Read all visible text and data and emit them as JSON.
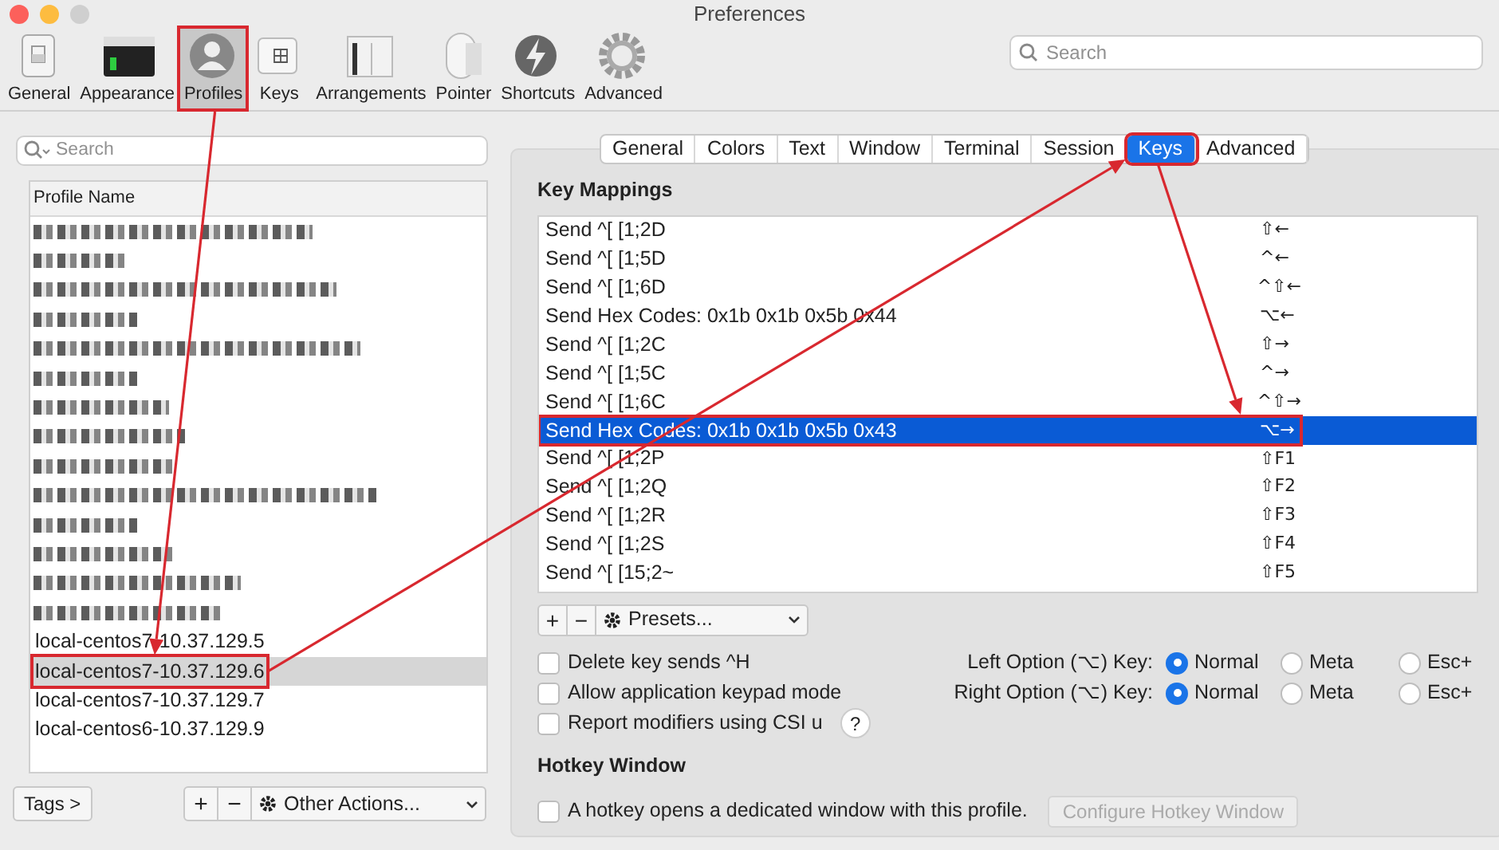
{
  "window": {
    "title": "Preferences"
  },
  "toolbar": [
    {
      "label": "General",
      "selected": false,
      "highlighted": false
    },
    {
      "label": "Appearance",
      "selected": false,
      "highlighted": false
    },
    {
      "label": "Profiles",
      "selected": true,
      "highlighted": true
    },
    {
      "label": "Keys",
      "selected": false,
      "highlighted": false
    },
    {
      "label": "Arrangements",
      "selected": false,
      "highlighted": false
    },
    {
      "label": "Pointer",
      "selected": false,
      "highlighted": false
    },
    {
      "label": "Shortcuts",
      "selected": false,
      "highlighted": false
    },
    {
      "label": "Advanced",
      "selected": false,
      "highlighted": false
    }
  ],
  "search": {
    "placeholder": "Search"
  },
  "profiles": {
    "search_placeholder": "Search",
    "column": "Profile Name",
    "rows": [
      {
        "kind": "redacted",
        "selected": false
      },
      {
        "kind": "redacted",
        "selected": false
      },
      {
        "kind": "redacted",
        "selected": false
      },
      {
        "kind": "redacted",
        "selected": false
      },
      {
        "kind": "redacted",
        "selected": false
      },
      {
        "kind": "redacted",
        "selected": false
      },
      {
        "kind": "redacted",
        "selected": false
      },
      {
        "kind": "redacted",
        "selected": false
      },
      {
        "kind": "redacted",
        "selected": false
      },
      {
        "kind": "redacted",
        "selected": false
      },
      {
        "kind": "redacted",
        "selected": false
      },
      {
        "kind": "redacted",
        "selected": false
      },
      {
        "kind": "redacted",
        "selected": false
      },
      {
        "kind": "redacted",
        "selected": false
      },
      {
        "kind": "text",
        "name": "local-centos7-10.37.129.5",
        "selected": false,
        "highlighted": false
      },
      {
        "kind": "text",
        "name": "local-centos7-10.37.129.6",
        "selected": true,
        "highlighted": true
      },
      {
        "kind": "text",
        "name": "local-centos7-10.37.129.7",
        "selected": false,
        "highlighted": false
      },
      {
        "kind": "text",
        "name": "local-centos6-10.37.129.9",
        "selected": false,
        "highlighted": false
      }
    ],
    "tags_button": "Tags >",
    "add": "+",
    "remove": "−",
    "actions": "Other Actions..."
  },
  "tabs": [
    {
      "label": "General",
      "selected": false,
      "highlighted": false
    },
    {
      "label": "Colors",
      "selected": false,
      "highlighted": false
    },
    {
      "label": "Text",
      "selected": false,
      "highlighted": false
    },
    {
      "label": "Window",
      "selected": false,
      "highlighted": false
    },
    {
      "label": "Terminal",
      "selected": false,
      "highlighted": false
    },
    {
      "label": "Session",
      "selected": false,
      "highlighted": false
    },
    {
      "label": "Keys",
      "selected": true,
      "highlighted": true
    },
    {
      "label": "Advanced",
      "selected": false,
      "highlighted": false
    }
  ],
  "key_mappings": {
    "title": "Key Mappings",
    "rows": [
      {
        "action": "Send ^[ [1;2D",
        "keys": "⇧←",
        "selected": false,
        "highlighted": false
      },
      {
        "action": "Send ^[ [1;5D",
        "keys": "^←",
        "selected": false,
        "highlighted": false
      },
      {
        "action": "Send ^[ [1;6D",
        "keys": "^⇧←",
        "selected": false,
        "highlighted": false
      },
      {
        "action": "Send Hex Codes: 0x1b 0x1b 0x5b 0x44",
        "keys": "⌥←",
        "selected": false,
        "highlighted": false
      },
      {
        "action": "Send ^[ [1;2C",
        "keys": "⇧→",
        "selected": false,
        "highlighted": false
      },
      {
        "action": "Send ^[ [1;5C",
        "keys": "^→",
        "selected": false,
        "highlighted": false
      },
      {
        "action": "Send ^[ [1;6C",
        "keys": "^⇧→",
        "selected": false,
        "highlighted": false
      },
      {
        "action": "Send Hex Codes: 0x1b 0x1b 0x5b 0x43",
        "keys": "⌥→",
        "selected": true,
        "highlighted": true
      },
      {
        "action": "Send ^[ [1;2P",
        "keys": "⇧F1",
        "selected": false,
        "highlighted": false
      },
      {
        "action": "Send ^[ [1;2Q",
        "keys": "⇧F2",
        "selected": false,
        "highlighted": false
      },
      {
        "action": "Send ^[ [1;2R",
        "keys": "⇧F3",
        "selected": false,
        "highlighted": false
      },
      {
        "action": "Send ^[ [1;2S",
        "keys": "⇧F4",
        "selected": false,
        "highlighted": false
      },
      {
        "action": "Send ^[ [15;2~",
        "keys": "⇧F5",
        "selected": false,
        "highlighted": false
      }
    ],
    "add": "+",
    "remove": "−",
    "presets": "Presets..."
  },
  "options": [
    {
      "label": "Delete key sends ^H",
      "checked": false
    },
    {
      "label": "Allow application keypad mode",
      "checked": false
    },
    {
      "label": "Report modifiers using CSI u",
      "checked": false,
      "help": "?"
    }
  ],
  "option_keys": [
    {
      "label": "Left Option (⌥) Key:",
      "choices": [
        {
          "label": "Normal",
          "selected": true
        },
        {
          "label": "Meta",
          "selected": false
        },
        {
          "label": "Esc+",
          "selected": false
        }
      ]
    },
    {
      "label": "Right Option (⌥) Key:",
      "choices": [
        {
          "label": "Normal",
          "selected": true
        },
        {
          "label": "Meta",
          "selected": false
        },
        {
          "label": "Esc+",
          "selected": false
        }
      ]
    }
  ],
  "hotkey": {
    "title": "Hotkey Window",
    "checkbox": {
      "label": "A hotkey opens a dedicated window with this profile.",
      "checked": false
    },
    "button": {
      "label": "Configure Hotkey Window",
      "disabled": true
    }
  }
}
